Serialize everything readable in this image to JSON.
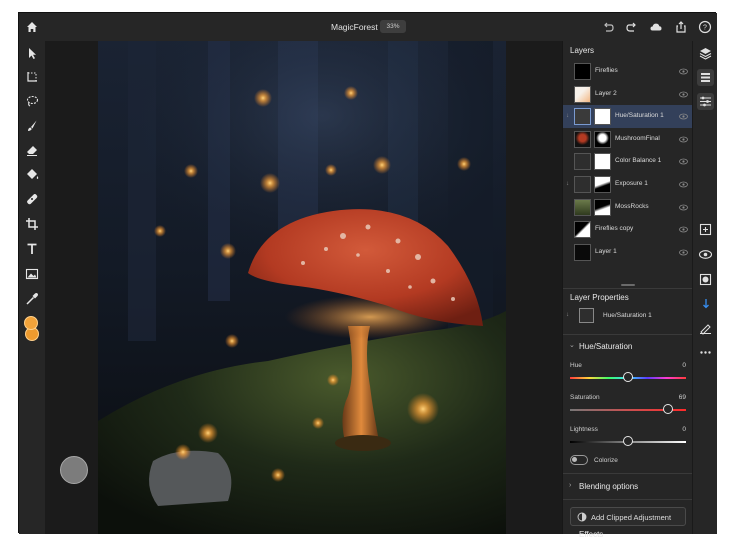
{
  "app": {
    "document_title": "MagicForest",
    "zoom": "33%"
  },
  "top_icons": [
    "home-icon",
    "undo-icon",
    "redo-icon",
    "cloud-icon",
    "share-icon",
    "help-icon"
  ],
  "tools": [
    "move-tool",
    "transform-tool",
    "lasso-select-tool",
    "brush-tool",
    "eraser-tool",
    "fill-tool",
    "healing-tool",
    "crop-tool",
    "text-tool",
    "place-image-tool",
    "eyedropper-tool"
  ],
  "colors": {
    "accent": "#378ef0",
    "foreground_swatch": "#f2a33a",
    "background_swatch": "#ed9a2e",
    "selected_row": "#33405a"
  },
  "layers": {
    "title": "Layers",
    "items": [
      {
        "name": "Fireflies",
        "selected": false
      },
      {
        "name": "Layer 2",
        "selected": false
      },
      {
        "name": "Hue/Saturation 1",
        "selected": true
      },
      {
        "name": "MushroomFinal",
        "selected": false
      },
      {
        "name": "Color Balance 1",
        "selected": false
      },
      {
        "name": "Exposure 1",
        "selected": false
      },
      {
        "name": "MossRocks",
        "selected": false
      },
      {
        "name": "Fireflies copy",
        "selected": false
      },
      {
        "name": "Layer 1",
        "selected": false
      }
    ]
  },
  "properties": {
    "title": "Layer Properties",
    "layer_name": "Hue/Saturation 1",
    "section": "Hue/Saturation",
    "sliders": [
      {
        "label": "Hue",
        "value": "0",
        "fraction": 0.5
      },
      {
        "label": "Saturation",
        "value": "69",
        "fraction": 0.845
      },
      {
        "label": "Lightness",
        "value": "0",
        "fraction": 0.5
      }
    ],
    "colorize_label": "Colorize",
    "colorize_on": false,
    "blending_label": "Blending options",
    "add_button_label": "Add Clipped Adjustment",
    "more_section": "Effects"
  },
  "right_tools": [
    "layers-icon",
    "layer-stack-icon",
    "adjustments-icon",
    "add-layer-icon",
    "visibility-icon",
    "mask-icon",
    "clip-icon",
    "fx-icon",
    "more-icon"
  ]
}
